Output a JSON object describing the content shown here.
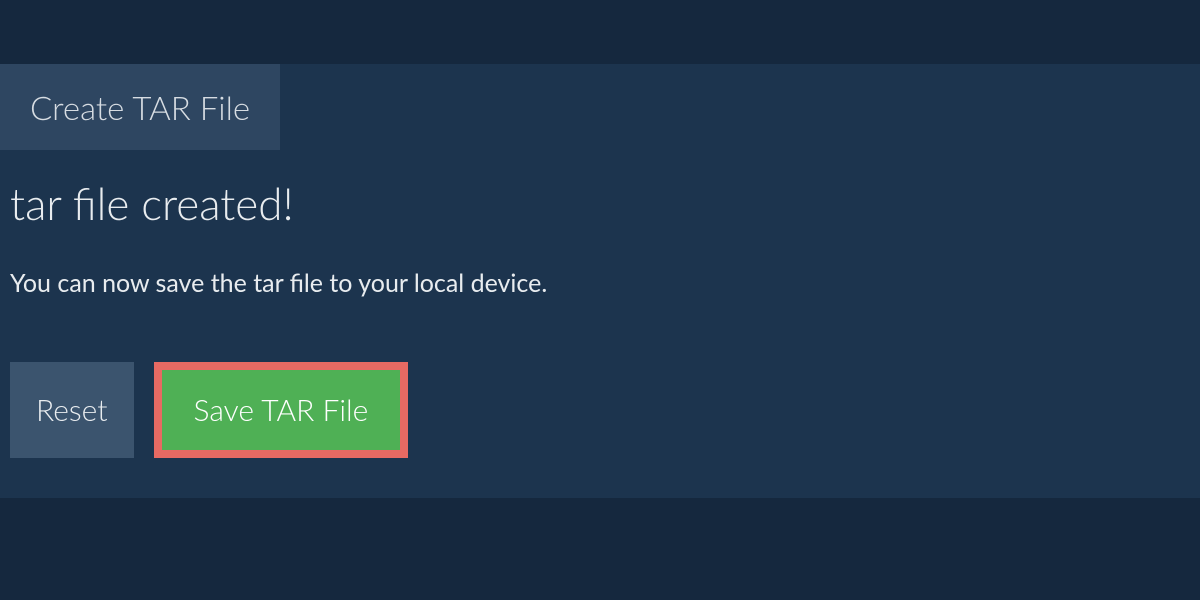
{
  "tab": {
    "label": "Create TAR File"
  },
  "content": {
    "heading": "tar file created!",
    "subtext": "You can now save the tar file to your local device."
  },
  "buttons": {
    "reset": "Reset",
    "save": "Save TAR File"
  }
}
